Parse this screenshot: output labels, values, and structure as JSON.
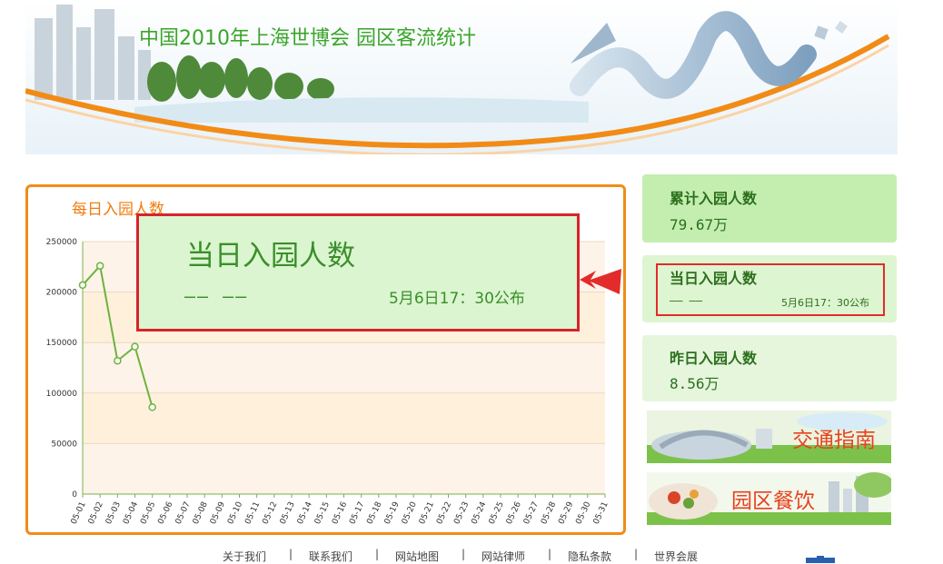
{
  "banner": {
    "title": "中国2010年上海世博会 园区客流统计"
  },
  "chart": {
    "heading": "每日入园人数",
    "y_ticks": [
      "250000",
      "200000",
      "150000",
      "100000",
      "50000",
      "0"
    ],
    "x_ticks": [
      "05-01",
      "05-02",
      "05-03",
      "05-04",
      "05-05",
      "05-06",
      "05-07",
      "05-08",
      "05-09",
      "05-10",
      "05-11",
      "05-12",
      "05-13",
      "05-14",
      "05-15",
      "05-16",
      "05-17",
      "05-18",
      "05-19",
      "05-20",
      "05-21",
      "05-22",
      "05-23",
      "05-24",
      "05-25",
      "05-26",
      "05-27",
      "05-28",
      "05-29",
      "05-30",
      "05-31"
    ],
    "line_color": "#6db33f"
  },
  "chart_data": {
    "type": "line",
    "title": "每日入园人数",
    "categories": [
      "05-01",
      "05-02",
      "05-03",
      "05-04",
      "05-05",
      "05-06",
      "05-07",
      "05-08",
      "05-09",
      "05-10",
      "05-11",
      "05-12",
      "05-13",
      "05-14",
      "05-15",
      "05-16",
      "05-17",
      "05-18",
      "05-19",
      "05-20",
      "05-21",
      "05-22",
      "05-23",
      "05-24",
      "05-25",
      "05-26",
      "05-27",
      "05-28",
      "05-29",
      "05-30",
      "05-31"
    ],
    "series": [
      {
        "values": [
          207000,
          226000,
          132000,
          146000,
          86000
        ]
      }
    ],
    "ylim": [
      0,
      250000
    ],
    "grid": true
  },
  "popup": {
    "title": "当日入园人数",
    "value": "—— ——",
    "time": "5月6日17：30公布"
  },
  "stats": [
    {
      "title": "累计入园人数",
      "value": "79.67万"
    },
    {
      "title": "当日入园人数",
      "value": "—— ——",
      "time": "5月6日17：30公布"
    },
    {
      "title": "昨日入园人数",
      "value": "8.56万"
    }
  ],
  "promos": [
    {
      "label": "交通指南"
    },
    {
      "label": "园区餐饮"
    }
  ],
  "footer": {
    "links": [
      "关于我们",
      "联系我们",
      "网站地图",
      "网站律师",
      "隐私条款",
      "世界会展"
    ],
    "separator": "|"
  },
  "colors": {
    "accent": "#f28b16",
    "green_text": "#2c6f1d",
    "red_highlight": "#e32b2b"
  }
}
